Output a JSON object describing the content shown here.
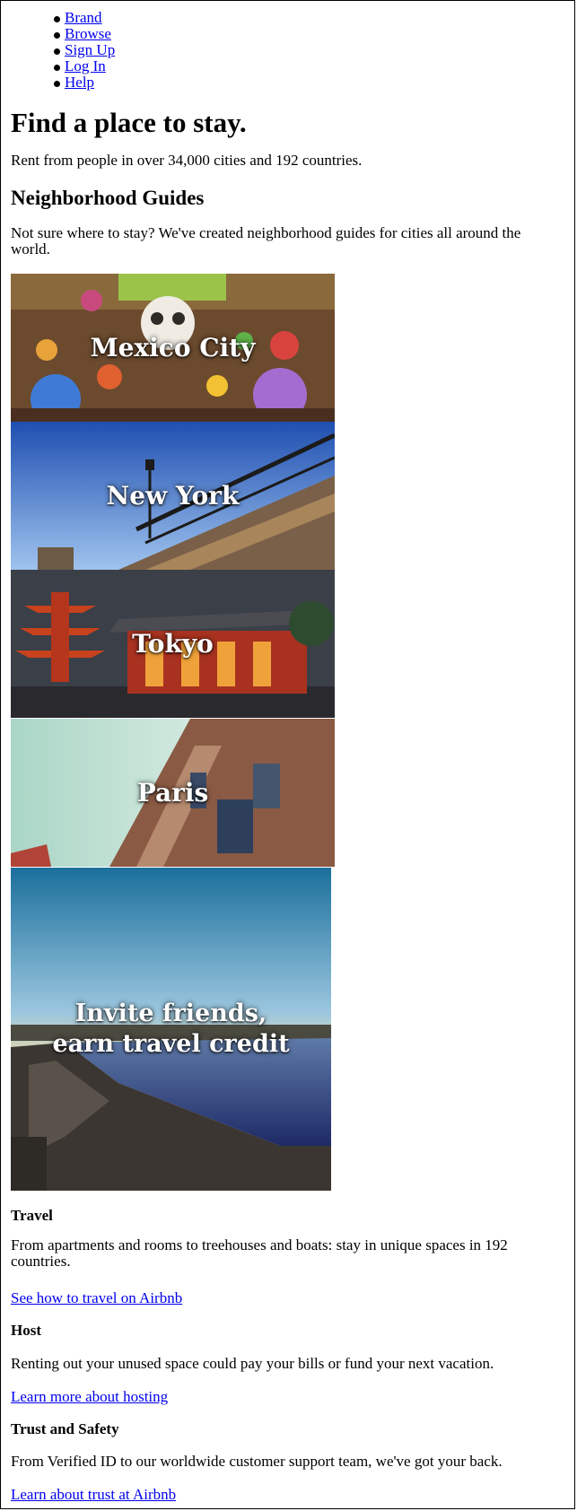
{
  "nav": {
    "items": [
      {
        "label": "Brand"
      },
      {
        "label": "Browse"
      },
      {
        "label": "Sign Up"
      },
      {
        "label": "Log In"
      },
      {
        "label": "Help"
      }
    ]
  },
  "hero": {
    "title": "Find a place to stay.",
    "subtitle": "Rent from people in over 34,000 cities and 192 countries."
  },
  "guides": {
    "heading": "Neighborhood Guides",
    "intro": "Not sure where to stay? We've created neighborhood guides for cities all around the world.",
    "cities": [
      {
        "label": "Mexico City"
      },
      {
        "label": "New York"
      },
      {
        "label": "Tokyo"
      },
      {
        "label": "Paris"
      }
    ]
  },
  "invite": {
    "line1": "Invite friends,",
    "line2": "earn travel credit"
  },
  "sections": [
    {
      "title": "Travel",
      "text": "From apartments and rooms to treehouses and boats: stay in unique spaces in 192 countries.",
      "link": "See how to travel on Airbnb"
    },
    {
      "title": "Host",
      "text": "Renting out your unused space could pay your bills or fund your next vacation.",
      "link": "Learn more about hosting"
    },
    {
      "title": "Trust and Safety",
      "text": "From Verified ID to our worldwide customer support team, we've got your back.",
      "link": "Learn about trust at Airbnb"
    }
  ],
  "colors": {
    "link": "#0000ee",
    "text": "#000000",
    "background": "#ffffff"
  }
}
